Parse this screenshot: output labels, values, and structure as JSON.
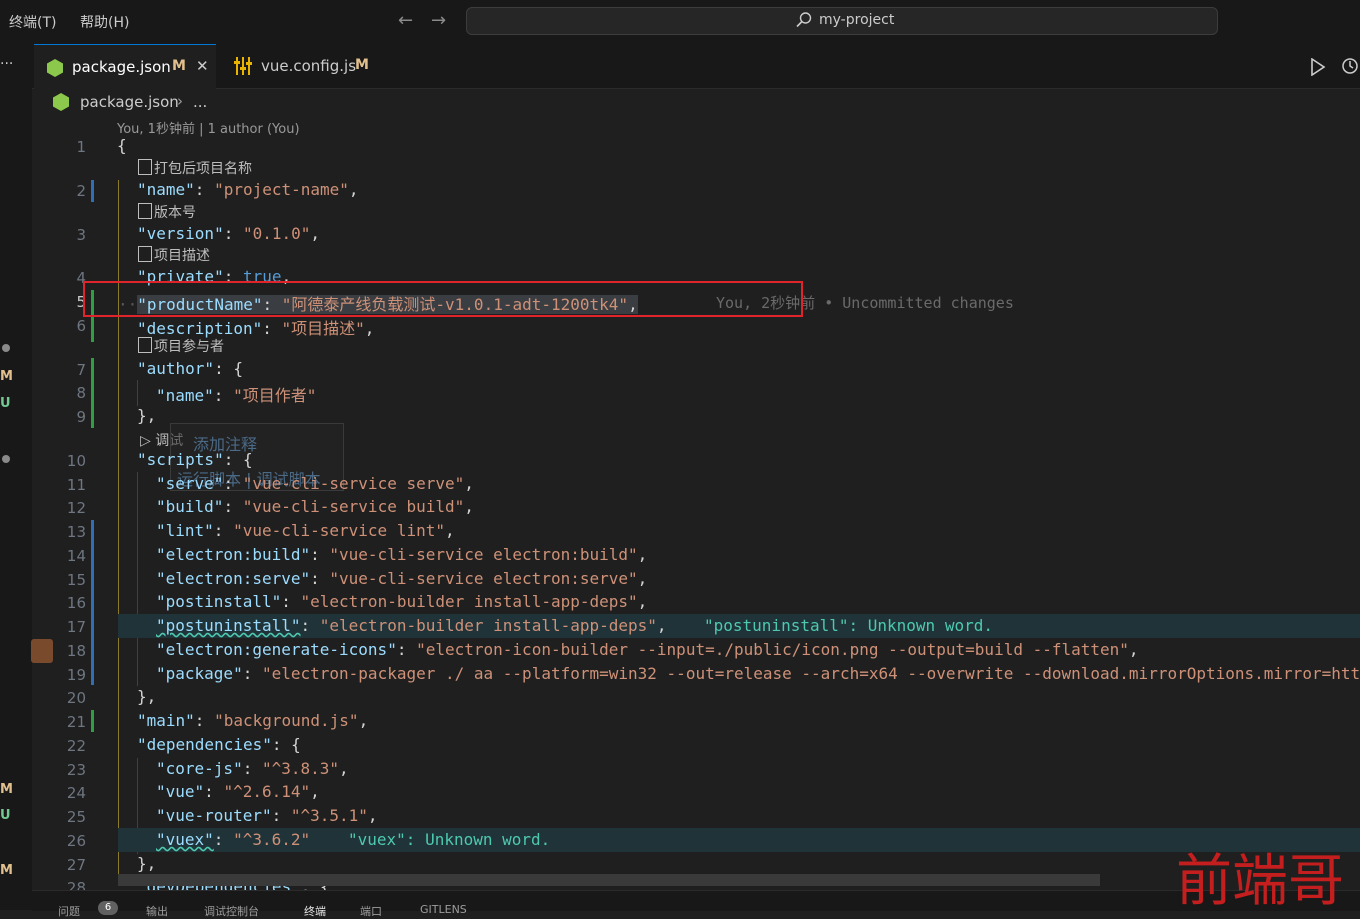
{
  "menu": {
    "terminal": "终端(T)",
    "help": "帮助(H)"
  },
  "nav": {
    "back": "←",
    "forward": "→"
  },
  "command_center": {
    "text": "my-project"
  },
  "tabs": [
    {
      "label": "package.json",
      "badge": "M",
      "close": "✕"
    },
    {
      "label": "vue.config.js",
      "badge": "M"
    }
  ],
  "breadcrumb": {
    "file": "package.json",
    "sep": "›",
    "more": "..."
  },
  "activity_letters": [
    "M",
    "U",
    "M",
    "U",
    "M"
  ],
  "codelens": {
    "top": "You, 1秒钟前 | 1 author (You)",
    "name": "打包后项目名称",
    "version": "版本号",
    "description": "项目描述",
    "author": "项目参与者",
    "debug": "调试",
    "add_comment": "添加注释",
    "run_script": "运行脚本 | 调试脚本"
  },
  "blame": "You, 2秒钟前 • Uncommitted changes",
  "warnings": {
    "postuninstall": "\"postuninstall\": Unknown word.",
    "vuex": "\"vuex\": Unknown word."
  },
  "lines": [
    {
      "n": "1"
    },
    {
      "n": "2"
    },
    {
      "n": "3"
    },
    {
      "n": "4"
    },
    {
      "n": "5"
    },
    {
      "n": "6"
    },
    {
      "n": "7"
    },
    {
      "n": "8"
    },
    {
      "n": "9"
    },
    {
      "n": "10"
    },
    {
      "n": "11"
    },
    {
      "n": "12"
    },
    {
      "n": "13"
    },
    {
      "n": "14"
    },
    {
      "n": "15"
    },
    {
      "n": "16"
    },
    {
      "n": "17"
    },
    {
      "n": "18"
    },
    {
      "n": "19"
    },
    {
      "n": "20"
    },
    {
      "n": "21"
    },
    {
      "n": "22"
    },
    {
      "n": "23"
    },
    {
      "n": "24"
    },
    {
      "n": "25"
    },
    {
      "n": "26"
    },
    {
      "n": "27"
    },
    {
      "n": "28"
    }
  ],
  "code": {
    "l1": "{",
    "l2k": "\"name\"",
    "l2v": "\"project-name\"",
    "l3k": "\"version\"",
    "l3v": "\"0.1.0\"",
    "l4k": "\"private\"",
    "l4v": "true",
    "l5k": "\"productName\"",
    "l5v": "\"阿德泰产线负载测试-v1.0.1-adt-1200tk4\"",
    "l6k": "\"description\"",
    "l6v": "\"项目描述\"",
    "l7k": "\"author\"",
    "l8k": "\"name\"",
    "l8v": "\"项目作者\"",
    "l9": "},",
    "l10k": "\"scripts\"",
    "l11k": "\"serve\"",
    "l11v": "\"vue-cli-service serve\"",
    "l12k": "\"build\"",
    "l12v": "\"vue-cli-service build\"",
    "l13k": "\"lint\"",
    "l13v": "\"vue-cli-service lint\"",
    "l14k": "\"electron:build\"",
    "l14v": "\"vue-cli-service electron:build\"",
    "l15k": "\"electron:serve\"",
    "l15v": "\"vue-cli-service electron:serve\"",
    "l16k": "\"postinstall\"",
    "l16v": "\"electron-builder install-app-deps\"",
    "l17k": "\"postuninstall\"",
    "l17v": "\"electron-builder install-app-deps\"",
    "l18k": "\"electron:generate-icons\"",
    "l18v": "\"electron-icon-builder --input=./public/icon.png --output=build --flatten\"",
    "l19k": "\"package\"",
    "l19v": "\"electron-packager ./ aa --platform=win32 --out=release --arch=x64 --overwrite --download.mirrorOptions.mirror=htt",
    "l20": "},",
    "l21k": "\"main\"",
    "l21v": "\"background.js\"",
    "l22k": "\"dependencies\"",
    "l23k": "\"core-js\"",
    "l23v": "\"^3.8.3\"",
    "l24k": "\"vue\"",
    "l24v": "\"^2.6.14\"",
    "l25k": "\"vue-router\"",
    "l25v": "\"^3.5.1\"",
    "l26k": "\"vuex\"",
    "l26v": "\"^3.6.2\"",
    "l27": "},",
    "l28k": "\"devDependencies\""
  },
  "bottom_tabs": [
    "问题",
    "6",
    "输出",
    "调试控制台",
    "终端",
    "端口",
    "GITLENS"
  ],
  "watermark": "前端哥",
  "colors": {
    "accent": "#0078d4",
    "modified": "#e2c08d",
    "highlight_box": "#e0242b"
  }
}
